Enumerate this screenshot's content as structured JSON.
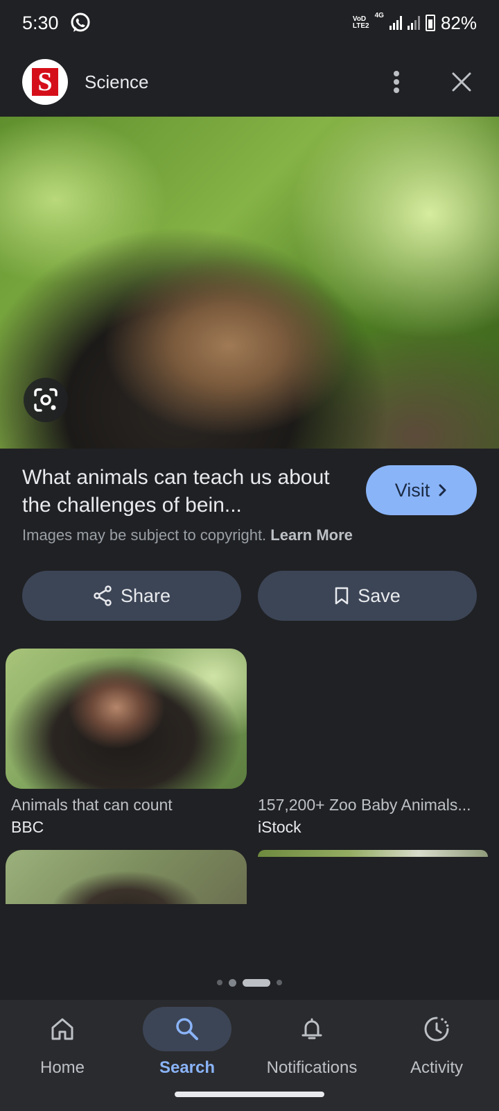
{
  "status_bar": {
    "time": "5:30",
    "app_icon": "whatsapp-icon",
    "network_top": "VoD",
    "network_bottom": "LTE2",
    "network_gen": "4G",
    "battery_percent": "82%"
  },
  "header": {
    "site_logo_letter": "S",
    "site_name": "Science",
    "more_icon": "more-vert-icon",
    "close_icon": "close-icon"
  },
  "hero": {
    "lens_icon": "lens-icon"
  },
  "info": {
    "title": "What animals can teach us about the challenges of bein...",
    "visit_label": "Visit",
    "copyright_text": "Images may be subject to copyright.",
    "learn_more": "Learn More"
  },
  "actions": {
    "share_label": "Share",
    "save_label": "Save"
  },
  "related": [
    {
      "title": "Animals that can count",
      "source": "BBC"
    },
    {
      "title": "157,200+ Zoo Baby Animals...",
      "source": "iStock"
    }
  ],
  "pager": {
    "pages": 4,
    "active_index": 2
  },
  "nav": {
    "items": [
      {
        "label": "Home",
        "icon": "home-icon"
      },
      {
        "label": "Search",
        "icon": "search-icon"
      },
      {
        "label": "Notifications",
        "icon": "bell-icon"
      },
      {
        "label": "Activity",
        "icon": "activity-icon"
      }
    ],
    "active": "Search"
  },
  "colors": {
    "background": "#202124",
    "accent": "#8ab4f8",
    "chip": "#3c4556",
    "logo_red": "#d50f1a"
  }
}
